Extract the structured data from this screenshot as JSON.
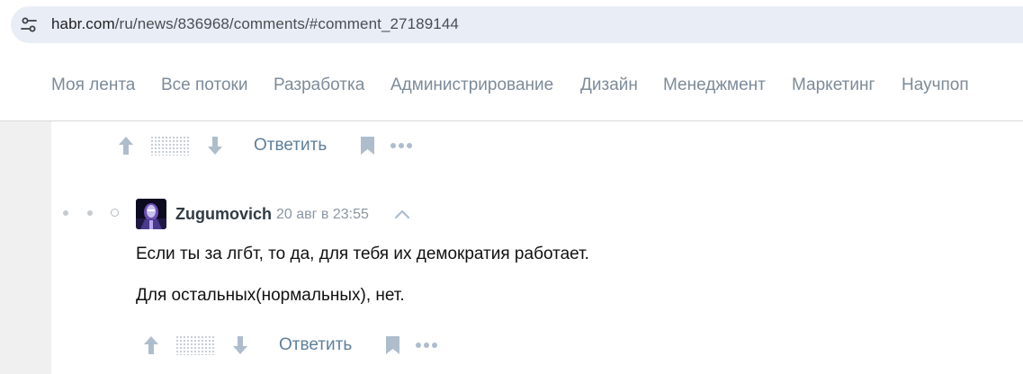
{
  "browser": {
    "url_host": "habr.com",
    "url_path": "/ru/news/836968/comments/#comment_27189144",
    "site_info_icon": "tune-icon"
  },
  "nav": {
    "items": [
      {
        "label": "Моя лента"
      },
      {
        "label": "Все потоки"
      },
      {
        "label": "Разработка"
      },
      {
        "label": "Администрирование"
      },
      {
        "label": "Дизайн"
      },
      {
        "label": "Менеджмент"
      },
      {
        "label": "Маркетинг"
      },
      {
        "label": "Научпоп"
      }
    ]
  },
  "previous_comment": {
    "reply_label": "Ответить"
  },
  "comment": {
    "author": "Zugumovich",
    "timestamp": "20 авг в 23:55",
    "paragraphs": [
      "Если ты за лгбт, то да, для тебя их демократия работает.",
      "Для остальных(нормальных), нет."
    ],
    "reply_label": "Ответить"
  },
  "colors": {
    "nav_text": "#7d8b99",
    "reply_link": "#5e7f9b",
    "icon_muted": "#aebdcc",
    "url_pill": "#e9eef6"
  }
}
